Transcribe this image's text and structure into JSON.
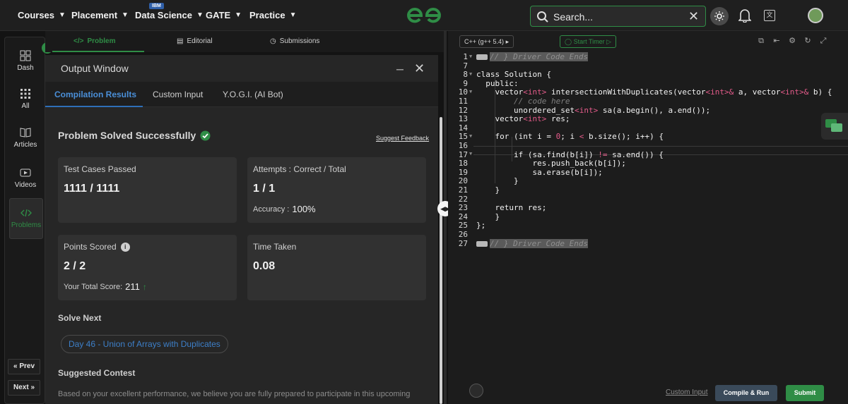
{
  "topnav": {
    "items": [
      {
        "label": "Courses"
      },
      {
        "label": "Placement"
      },
      {
        "label": "Data Science",
        "badge": "IBM"
      },
      {
        "label": "GATE"
      },
      {
        "label": "Practice"
      }
    ],
    "search_placeholder": "Search...",
    "accent": "#2f8d46"
  },
  "sidebar": {
    "items": [
      {
        "label": "Dash",
        "icon": "dashboard-icon"
      },
      {
        "label": "All",
        "icon": "grid-icon"
      },
      {
        "label": "Articles",
        "icon": "book-icon"
      },
      {
        "label": "Videos",
        "icon": "video-icon"
      },
      {
        "label": "Problems",
        "icon": "code-icon"
      }
    ],
    "prev_label": "Prev",
    "next_label": "Next"
  },
  "problem_tabs": [
    {
      "label": "Problem"
    },
    {
      "label": "Editorial"
    },
    {
      "label": "Submissions"
    }
  ],
  "output": {
    "title": "Output Window",
    "tabs": [
      {
        "label": "Compilation Results"
      },
      {
        "label": "Custom Input"
      },
      {
        "label": "Y.O.G.I. (AI Bot)"
      }
    ],
    "status": "Problem Solved Successfully",
    "feedback_link": "Suggest Feedback",
    "cards": {
      "test_cases": {
        "label": "Test Cases Passed",
        "value": "1111 / 1111"
      },
      "attempts": {
        "label": "Attempts : Correct / Total",
        "value": "1 / 1",
        "sub_label": "Accuracy :",
        "sub_value": "100%"
      },
      "points": {
        "label": "Points Scored",
        "value": "2 / 2",
        "sub_label": "Your Total Score:",
        "sub_value": "211"
      },
      "time": {
        "label": "Time Taken",
        "value": "0.08"
      }
    },
    "solve_next_heading": "Solve Next",
    "solve_next_item": "Day 46 - Union of Arrays with Duplicates",
    "contest_heading": "Suggested Contest",
    "contest_text": "Based on your excellent performance, we believe you are fully prepared to participate in this upcoming"
  },
  "editor": {
    "language": "C++ (g++ 5.4)",
    "timer_label": "Start Timer",
    "line_numbers": [
      "1",
      "7",
      "8",
      "9",
      "10",
      "11",
      "12",
      "13",
      "14",
      "15",
      "16",
      "17",
      "18",
      "19",
      "20",
      "21",
      "22",
      "23",
      "24",
      "25",
      "26",
      "27"
    ],
    "custom_input_label": "Custom Input",
    "compile_label": "Compile & Run",
    "submit_label": "Submit"
  }
}
